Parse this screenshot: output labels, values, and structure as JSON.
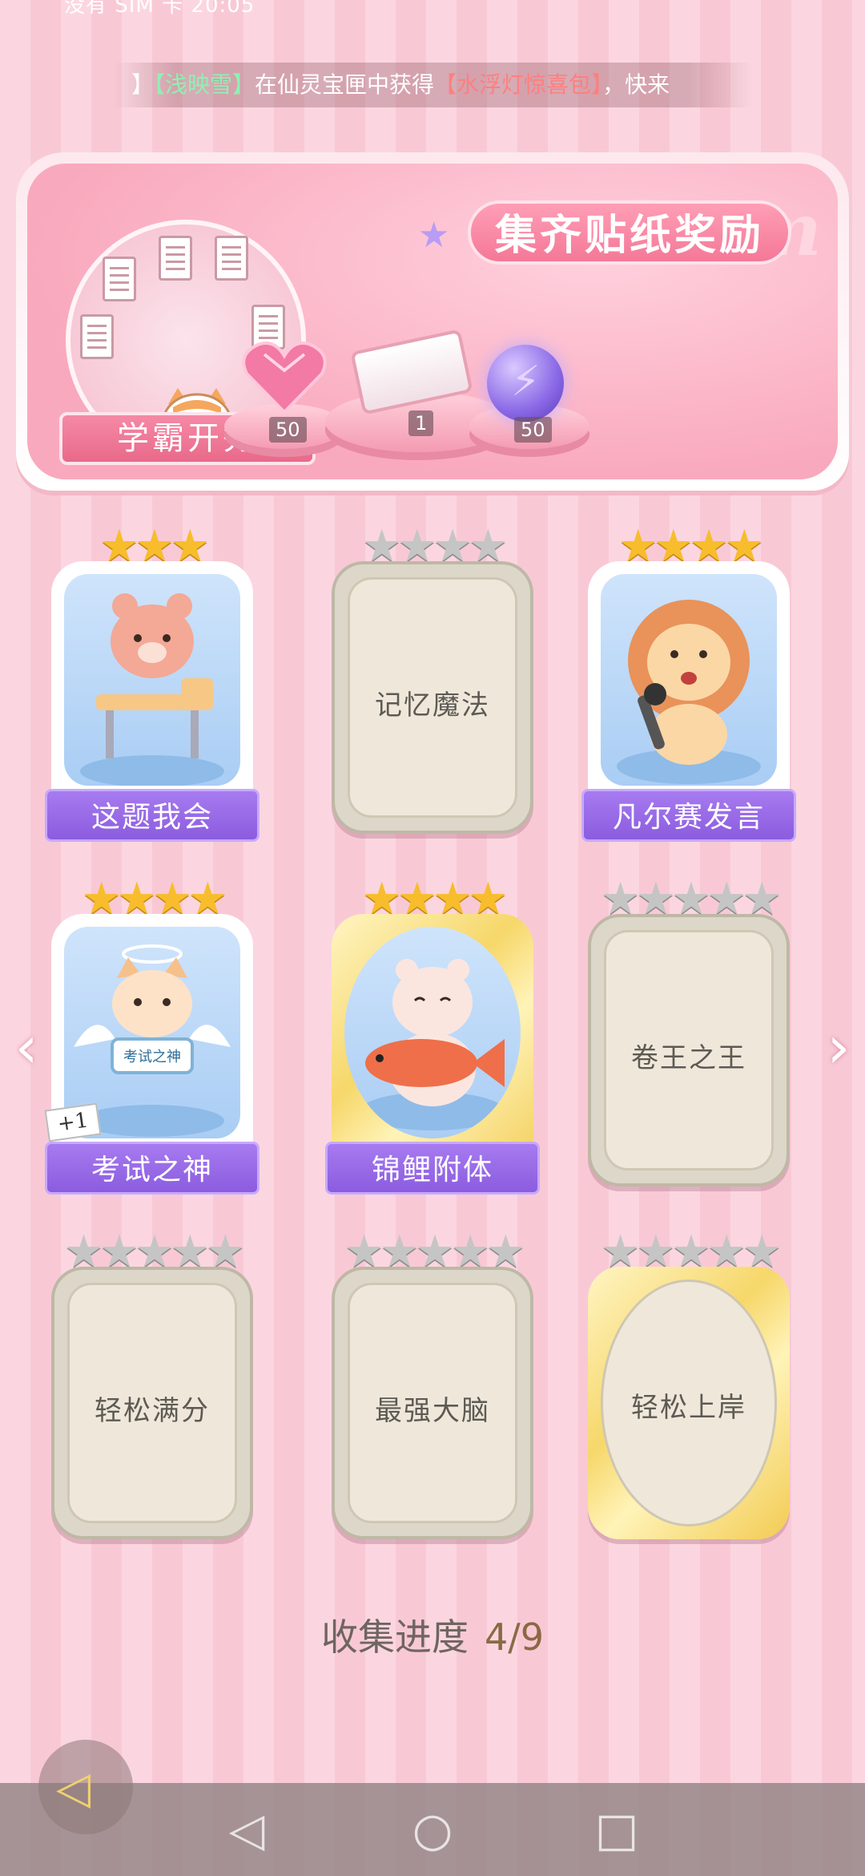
{
  "status_bar": {
    "left_text": "没有 SIM 卡 20:05",
    "right_text": ""
  },
  "marquee": {
    "prefix": "】",
    "name": "【浅映雪】",
    "middle": "在仙灵宝匣中获得",
    "item": "【水浮灯惊喜包】",
    "suffix": "，快来"
  },
  "reward_panel": {
    "title": "集齐贴纸奖励",
    "watermark": "Redeem",
    "badge_label": "学霸开秀",
    "rewards": [
      {
        "icon": "heart-gem-icon",
        "count": "50"
      },
      {
        "icon": "gift-box-icon",
        "count": "1"
      },
      {
        "icon": "lightning-orb-icon",
        "count": "50"
      }
    ]
  },
  "stickers": [
    {
      "label": "这题我会",
      "stars": 3,
      "max_stars": 3,
      "state": "collected",
      "art": "bear-at-desk"
    },
    {
      "label": "记忆魔法",
      "stars": 0,
      "max_stars": 4,
      "state": "locked"
    },
    {
      "label": "凡尔赛发言",
      "stars": 4,
      "max_stars": 4,
      "state": "collected",
      "art": "lion-microphone"
    },
    {
      "label": "考试之神",
      "stars": 4,
      "max_stars": 4,
      "state": "collected",
      "art": "angel-cat",
      "extra": "+1",
      "sign_text": "考试之神"
    },
    {
      "label": "锦鲤附体",
      "stars": 4,
      "max_stars": 4,
      "state": "collected",
      "art": "bear-koi",
      "frame": "gold"
    },
    {
      "label": "卷王之王",
      "stars": 0,
      "max_stars": 5,
      "state": "locked"
    },
    {
      "label": "轻松满分",
      "stars": 0,
      "max_stars": 5,
      "state": "locked"
    },
    {
      "label": "最强大脑",
      "stars": 0,
      "max_stars": 5,
      "state": "locked"
    },
    {
      "label": "轻松上岸",
      "stars": 0,
      "max_stars": 5,
      "state": "locked",
      "frame": "gold"
    }
  ],
  "progress": {
    "label": "收集进度",
    "value": "4/9"
  },
  "nav": {
    "prev_icon": "chevron-left-icon",
    "next_icon": "chevron-right-icon"
  },
  "system_nav": {
    "back": "◁",
    "home": "○",
    "recent": "□"
  }
}
